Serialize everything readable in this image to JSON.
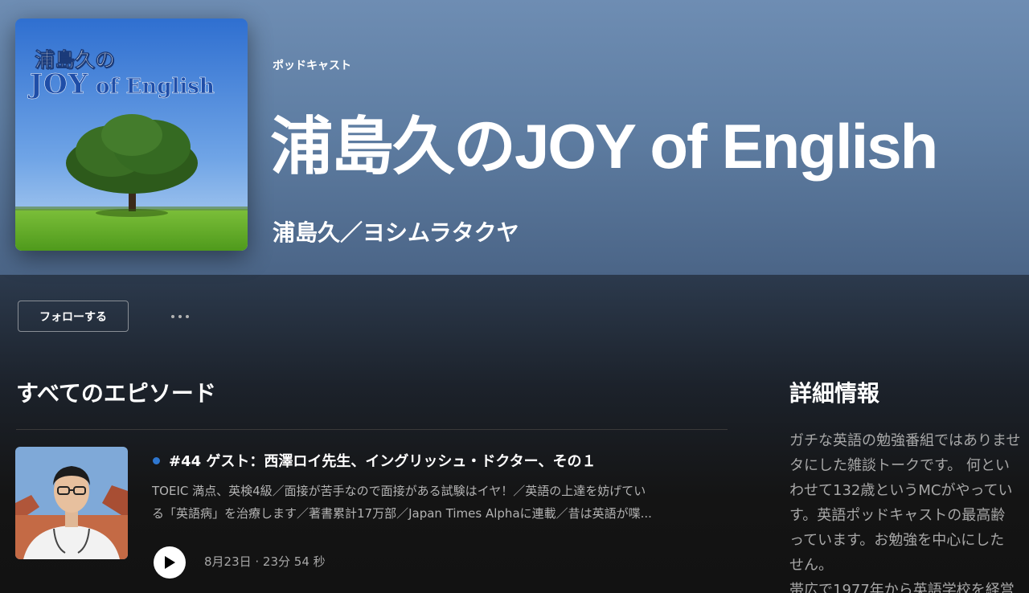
{
  "podcast": {
    "type_label": "ポッドキャスト",
    "title": "浦島久のJOY of English",
    "author": "浦島久／ヨシムラタクヤ",
    "cover": {
      "line1": "浦島久の",
      "line2_joy": "JOY",
      "line2_rest": " of English"
    }
  },
  "actions": {
    "follow_label": "フォローする",
    "more_label": "その他のオプション"
  },
  "episodes_section": {
    "title": "すべてのエピソード",
    "episodes": [
      {
        "title": "#44 ゲスト：西澤ロイ先生、イングリッシュ・ドクター、その１",
        "description_line1": "TOEIC 満点、英検4級／面接が苦手なので面接がある試験はイヤ！／英語の上達を妨げてい",
        "description_line2": "る「英語病」を治療します／著書累計17万部／Japan Times Alphaに連載／昔は英語が喋...",
        "meta": "8月23日 ·  23分 54 秒"
      }
    ]
  },
  "about": {
    "title": "詳細情報",
    "lines": [
      "ガチな英語の勉強番組ではありませ",
      "タにした雑談トークです。 何とい",
      "わせて132歳というMCがやってい",
      "す。英語ポッドキャストの最高齢",
      "っています。お勉強を中心にした",
      "せん。",
      "帯広で1977年から英語学校を経営"
    ]
  },
  "colors": {
    "hero_top": "#6e8db3",
    "hero_bottom": "#4b6587",
    "background": "#121212",
    "accent_blue": "#2e77d0"
  }
}
